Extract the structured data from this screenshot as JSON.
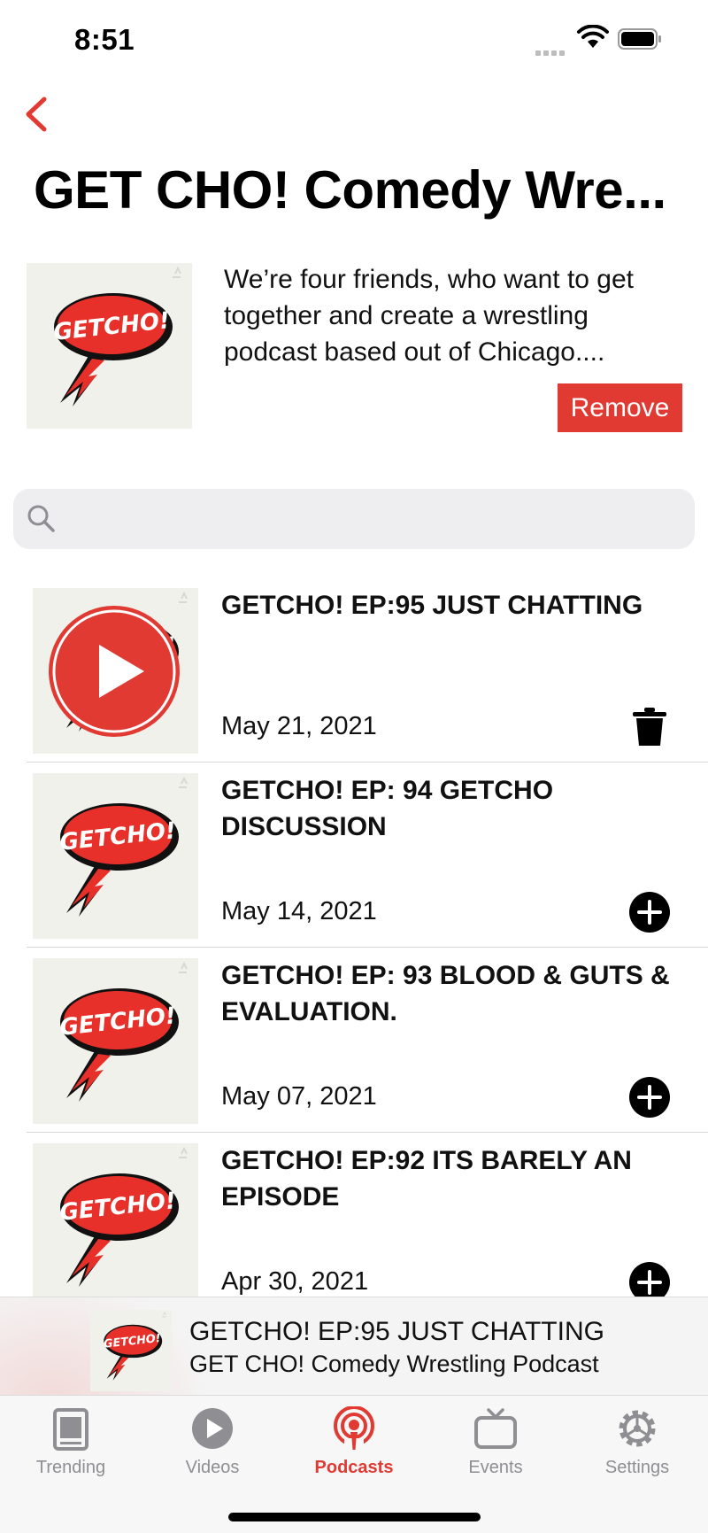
{
  "status": {
    "time": "8:51"
  },
  "header": {
    "title": "GET CHO! Comedy Wre...",
    "back_icon": "chevron-left-icon"
  },
  "podcast": {
    "description": "We’re four friends, who want to get together and create a wrestling podcast based out of Chicago....",
    "remove_label": "Remove",
    "cover_text": "GETCHO!"
  },
  "search": {
    "placeholder": "",
    "value": ""
  },
  "episodes": [
    {
      "title": "GETCHO! EP:95 JUST CHATTING",
      "date": "May 21, 2021",
      "action_icon": "trash-icon",
      "playing": true
    },
    {
      "title": "GETCHO! EP: 94 GETCHO DISCUSSION",
      "date": "May 14, 2021",
      "action_icon": "add-circle-icon",
      "playing": false
    },
    {
      "title": "GETCHO! EP: 93 BLOOD & GUTS & EVALUATION.",
      "date": "May 07, 2021",
      "action_icon": "add-circle-icon",
      "playing": false
    },
    {
      "title": "GETCHO! EP:92 ITS BARELY AN EPISODE",
      "date": "Apr 30, 2021",
      "action_icon": "add-circle-icon",
      "playing": false
    }
  ],
  "mini_player": {
    "title": "GETCHO! EP:95 JUST CHATTING",
    "subtitle": "GET CHO! Comedy Wrestling Podcast"
  },
  "tabs": [
    {
      "label": "Trending",
      "icon": "newspaper-icon",
      "active": false
    },
    {
      "label": "Videos",
      "icon": "play-circle-icon",
      "active": false
    },
    {
      "label": "Podcasts",
      "icon": "podcast-icon",
      "active": true
    },
    {
      "label": "Events",
      "icon": "tv-icon",
      "active": false
    },
    {
      "label": "Settings",
      "icon": "gear-icon",
      "active": false
    }
  ],
  "colors": {
    "accent": "#e03a33",
    "tab_inactive": "#8e8e93",
    "cover_bg": "#f1f1ec"
  }
}
